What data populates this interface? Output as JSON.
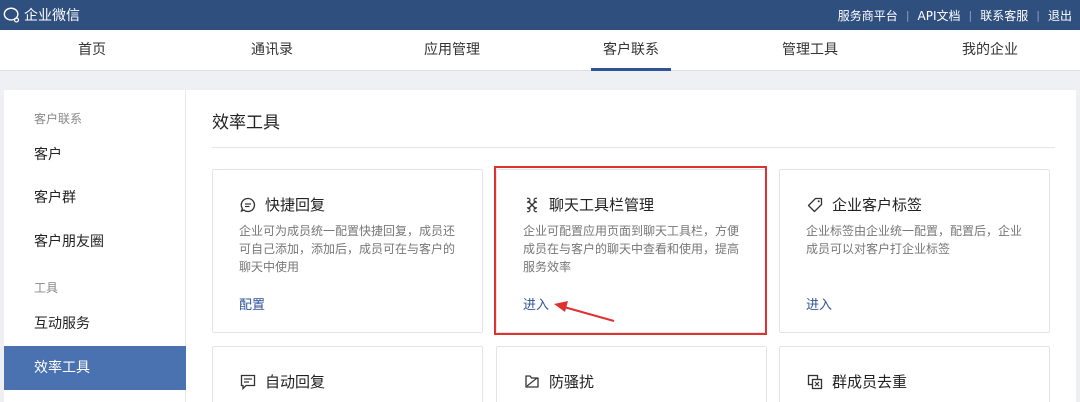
{
  "brand": {
    "name": "企业微信",
    "icon": "wecom-logo-icon"
  },
  "top_links": [
    "服务商平台",
    "API文档",
    "联系客服",
    "退出"
  ],
  "nav": {
    "items": [
      "首页",
      "通讯录",
      "应用管理",
      "客户联系",
      "管理工具",
      "我的企业"
    ],
    "active": "客户联系"
  },
  "sidebar": {
    "group1": "客户联系",
    "group1_items": [
      "客户",
      "客户群",
      "客户朋友圈"
    ],
    "group2": "工具",
    "group2_items": [
      "互动服务",
      "效率工具"
    ],
    "active": "效率工具"
  },
  "main": {
    "title": "效率工具",
    "cards": [
      {
        "title": "快捷回复",
        "icon": "chat-bubble-icon",
        "desc": "企业可为成员统一配置快捷回复，成员还可自己添加，添加后，成员可在与客户的聊天中使用",
        "link": "配置"
      },
      {
        "title": "聊天工具栏管理",
        "icon": "toolbar-icon",
        "desc": "企业可配置应用页面到聊天工具栏，方便成员在与客户的聊天中查看和使用，提高服务效率",
        "link": "进入"
      },
      {
        "title": "企业客户标签",
        "icon": "tag-icon",
        "desc": "企业标签由企业统一配置，配置后，企业成员可以对客户打企业标签",
        "link": "进入"
      },
      {
        "title": "自动回复",
        "icon": "auto-reply-icon"
      },
      {
        "title": "防骚扰",
        "icon": "flag-icon"
      },
      {
        "title": "群成员去重",
        "icon": "dedupe-icon"
      }
    ]
  },
  "colors": {
    "topbar": "#2f4f7f",
    "accent": "#2f5597",
    "sidebar_active": "#4a72b0",
    "highlight": "#e03131"
  }
}
